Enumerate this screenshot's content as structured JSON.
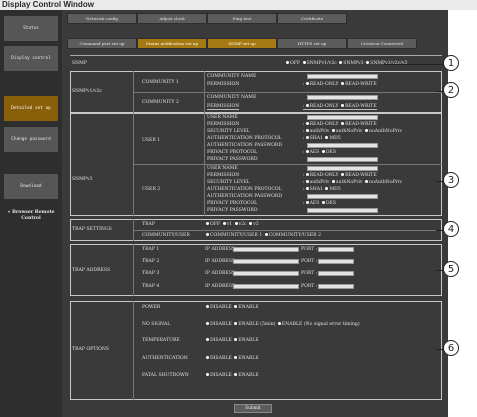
{
  "window": {
    "title": "Display Control Window"
  },
  "sidebar": {
    "items": [
      {
        "label": "Status"
      },
      {
        "label": "Display control"
      },
      {
        "label": "Detailed set up"
      },
      {
        "label": "Change password"
      },
      {
        "label": "Download"
      },
      {
        "label": "» Browser Remote Control"
      }
    ]
  },
  "tabs": [
    {
      "label": "Network config"
    },
    {
      "label": "Adjust clock"
    },
    {
      "label": "Ping test"
    },
    {
      "label": "Certificate"
    },
    {
      "label": "Command port set up"
    },
    {
      "label": "Status notification set up"
    },
    {
      "label": "SNMP set up"
    },
    {
      "label": "HTTPS set up"
    },
    {
      "label": "Crestron Connected"
    }
  ],
  "snmp": {
    "label": "SNMP",
    "options": [
      "OFF",
      "SNMPv1/v2c",
      "SNMPv3",
      "SNMPv1/v2c/v3"
    ]
  },
  "v1v2c": {
    "section": "SNMPv1/v2c",
    "communities": [
      {
        "name": "COMMUNITY 1",
        "fields": [
          "COMMUNITY NAME",
          "PERMISSION"
        ]
      },
      {
        "name": "COMMUNITY 2",
        "fields": [
          "COMMUNITY NAME",
          "PERMISSION"
        ]
      }
    ],
    "permission_options": [
      "READ-ONLY",
      "READ-WRITE"
    ]
  },
  "v3": {
    "section": "SNMPv3",
    "users": [
      {
        "name": "USER 1"
      },
      {
        "name": "USER 2"
      }
    ],
    "fields": [
      "USER NAME",
      "PERMISSION",
      "SECURITY LEVEL",
      "AUTHENTICATION PROTOCOL",
      "AUTHENTICATION PASSWORD",
      "PRIVACY PROTOCOL",
      "PRIVACY PASSWORD"
    ],
    "permission_options": [
      "READ-ONLY",
      "READ-WRITE"
    ],
    "security_options": [
      "authPriv",
      "authNoPriv",
      "noAuthNoPriv"
    ],
    "auth_options": [
      "SHA1",
      "MD5"
    ],
    "privacy_options": [
      "AES",
      "DES"
    ]
  },
  "trap_settings": {
    "section": "TRAP SETTINGS",
    "trap_label": "TRAP",
    "trap_options": [
      "OFF",
      "v1",
      "v2c",
      "v3"
    ],
    "cu_label": "COMMUNITY/USER",
    "cu_options": [
      "COMMUNITY/USER 1",
      "COMMUNITY/USER 2"
    ]
  },
  "trap_address": {
    "section": "TRAP ADDRESS",
    "rows": [
      {
        "label": "TRAP 1"
      },
      {
        "label": "TRAP 2"
      },
      {
        "label": "TRAP 3"
      },
      {
        "label": "TRAP 4"
      }
    ],
    "ip_label": "IP ADDRESS :",
    "port_label": "PORT :"
  },
  "trap_options": {
    "section": "TRAP OPTIONS",
    "rows": [
      {
        "label": "POWER",
        "options": [
          "DISABLE",
          "ENABLE"
        ]
      },
      {
        "label": "NO SIGNAL",
        "options": [
          "DISABLE",
          "ENABLE (5min)",
          "ENABLE (No signal error timing)"
        ]
      },
      {
        "label": "TEMPERATURE",
        "options": [
          "DISABLE",
          "ENABLE"
        ]
      },
      {
        "label": "AUTHENTICATION",
        "options": [
          "DISABLE",
          "ENABLE"
        ]
      },
      {
        "label": "FATAL SHUTDOWN",
        "options": [
          "DISABLE",
          "ENABLE"
        ]
      }
    ]
  },
  "submit_label": "Submit",
  "callouts": [
    "1",
    "2",
    "3",
    "4",
    "5",
    "6"
  ]
}
